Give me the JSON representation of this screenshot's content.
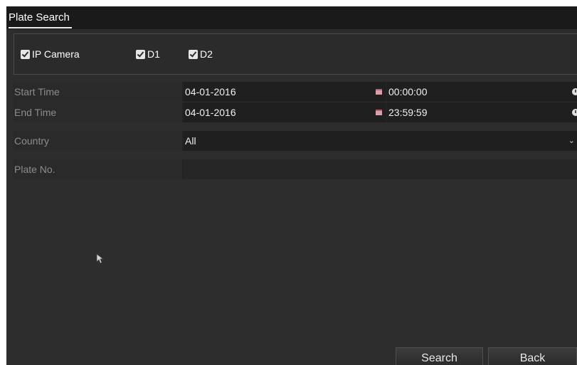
{
  "title": "Plate Search",
  "cameras": [
    {
      "label": "IP Camera",
      "checked": true
    },
    {
      "label": "D1",
      "checked": true
    },
    {
      "label": "D2",
      "checked": true
    }
  ],
  "start_time": {
    "label": "Start Time",
    "date": "04-01-2016",
    "time": "00:00:00"
  },
  "end_time": {
    "label": "End Time",
    "date": "04-01-2016",
    "time": "23:59:59"
  },
  "country": {
    "label": "Country",
    "value": "All"
  },
  "plate": {
    "label": "Plate No.",
    "value": ""
  },
  "buttons": {
    "search": "Search",
    "back": "Back"
  },
  "colors": {
    "panel": "#2d2d2d",
    "header": "#1a1a1a",
    "text": "#ffffff",
    "label": "#8c8c8c"
  },
  "icons": {
    "checkbox": "checkbox-checked-icon",
    "calendar": "calendar-icon",
    "clock": "clock-icon",
    "dropdown": "chevron-down-icon",
    "cursor": "mouse-pointer-icon"
  }
}
